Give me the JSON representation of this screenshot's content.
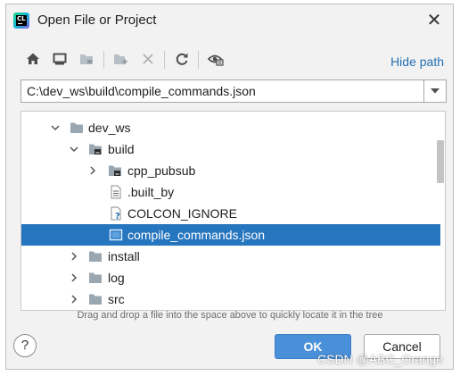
{
  "window": {
    "title": "Open File or Project",
    "app_icon_text": "CL",
    "close_icon": "close-icon"
  },
  "toolbar": {
    "buttons": [
      {
        "icon": "home-icon",
        "enabled": true
      },
      {
        "icon": "desktop-icon",
        "enabled": true
      },
      {
        "icon": "project-folder-icon",
        "enabled": false
      },
      {
        "icon": "new-folder-icon",
        "enabled": false
      },
      {
        "icon": "delete-icon",
        "enabled": false
      },
      {
        "icon": "refresh-icon",
        "enabled": true
      },
      {
        "icon": "show-hidden-icon",
        "enabled": true
      }
    ],
    "hide_path_label": "Hide path"
  },
  "path": {
    "value": "C:\\dev_ws\\build\\compile_commands.json"
  },
  "tree": {
    "items": [
      {
        "label": "dev_ws",
        "depth": 0,
        "kind": "folder",
        "expanded": true,
        "selected": false
      },
      {
        "label": "build",
        "depth": 1,
        "kind": "folder-special",
        "expanded": true,
        "selected": false
      },
      {
        "label": "cpp_pubsub",
        "depth": 2,
        "kind": "folder-special",
        "expanded": false,
        "selected": false
      },
      {
        "label": ".built_by",
        "depth": 2,
        "kind": "text-file",
        "expandable": false,
        "selected": false
      },
      {
        "label": "COLCON_IGNORE",
        "depth": 2,
        "kind": "unknown-file",
        "expandable": false,
        "selected": false
      },
      {
        "label": "compile_commands.json",
        "depth": 2,
        "kind": "json-file",
        "expandable": false,
        "selected": true
      },
      {
        "label": "install",
        "depth": 1,
        "kind": "folder",
        "expanded": false,
        "selected": false
      },
      {
        "label": "log",
        "depth": 1,
        "kind": "folder",
        "expanded": false,
        "selected": false
      },
      {
        "label": "src",
        "depth": 1,
        "kind": "folder",
        "expanded": false,
        "selected": false
      }
    ]
  },
  "hint": "Drag and drop a file into the space above to quickly locate it in the tree",
  "buttons": {
    "help": "?",
    "ok": "OK",
    "cancel": "Cancel"
  },
  "watermark": "CSDN @ABC_Orange",
  "colors": {
    "selection": "#2675bf",
    "link": "#2470b3",
    "ok_button": "#4a90d9",
    "folder": "#9aa7b0"
  }
}
